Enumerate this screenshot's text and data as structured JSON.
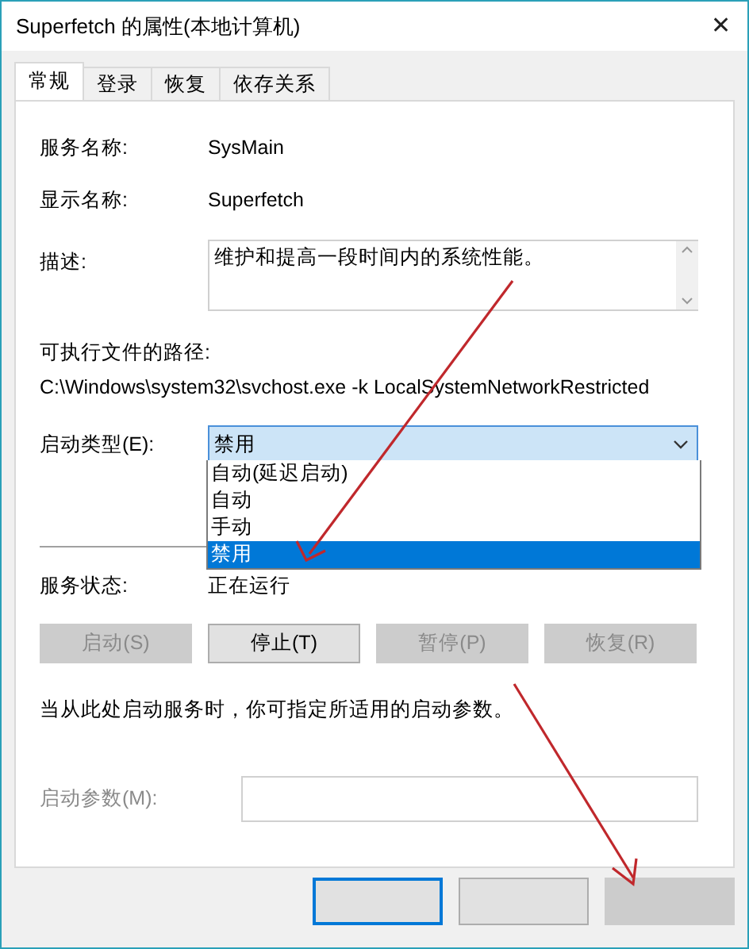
{
  "window": {
    "title": "Superfetch 的属性(本地计算机)",
    "close": "✕"
  },
  "tabs": [
    {
      "label": "常规",
      "selected": true
    },
    {
      "label": "登录",
      "selected": false
    },
    {
      "label": "恢复",
      "selected": false
    },
    {
      "label": "依存关系",
      "selected": false
    }
  ],
  "fields": [
    {
      "label": "服务名称:",
      "value": "SysMain"
    },
    {
      "label": "显示名称:",
      "value": "Superfetch"
    }
  ],
  "description": {
    "label": "描述:",
    "value": "维护和提高一段时间内的系统性能。"
  },
  "path": {
    "label": "可执行文件的路径:",
    "value": "C:\\Windows\\system32\\svchost.exe -k LocalSystemNetworkRestricted"
  },
  "startup_type": {
    "label": "启动类型(E):",
    "value": "禁用",
    "expanded": true,
    "options": [
      {
        "label": "自动(延迟启动)",
        "selected": false
      },
      {
        "label": "自动",
        "selected": false
      },
      {
        "label": "手动",
        "selected": false
      },
      {
        "label": "禁用",
        "selected": true
      }
    ]
  },
  "service_status": {
    "label": "服务状态:",
    "value": "正在运行"
  },
  "service_buttons": [
    {
      "label": "启动(S)",
      "disabled": true
    },
    {
      "label": "停止(T)",
      "disabled": false
    },
    {
      "label": "暂停(P)",
      "disabled": true
    },
    {
      "label": "恢复(R)",
      "disabled": true
    }
  ],
  "hint": "当从此处启动服务时，你可指定所适用的启动参数。",
  "start_parameters": {
    "label": "启动参数(M):",
    "disabled": true
  }
}
